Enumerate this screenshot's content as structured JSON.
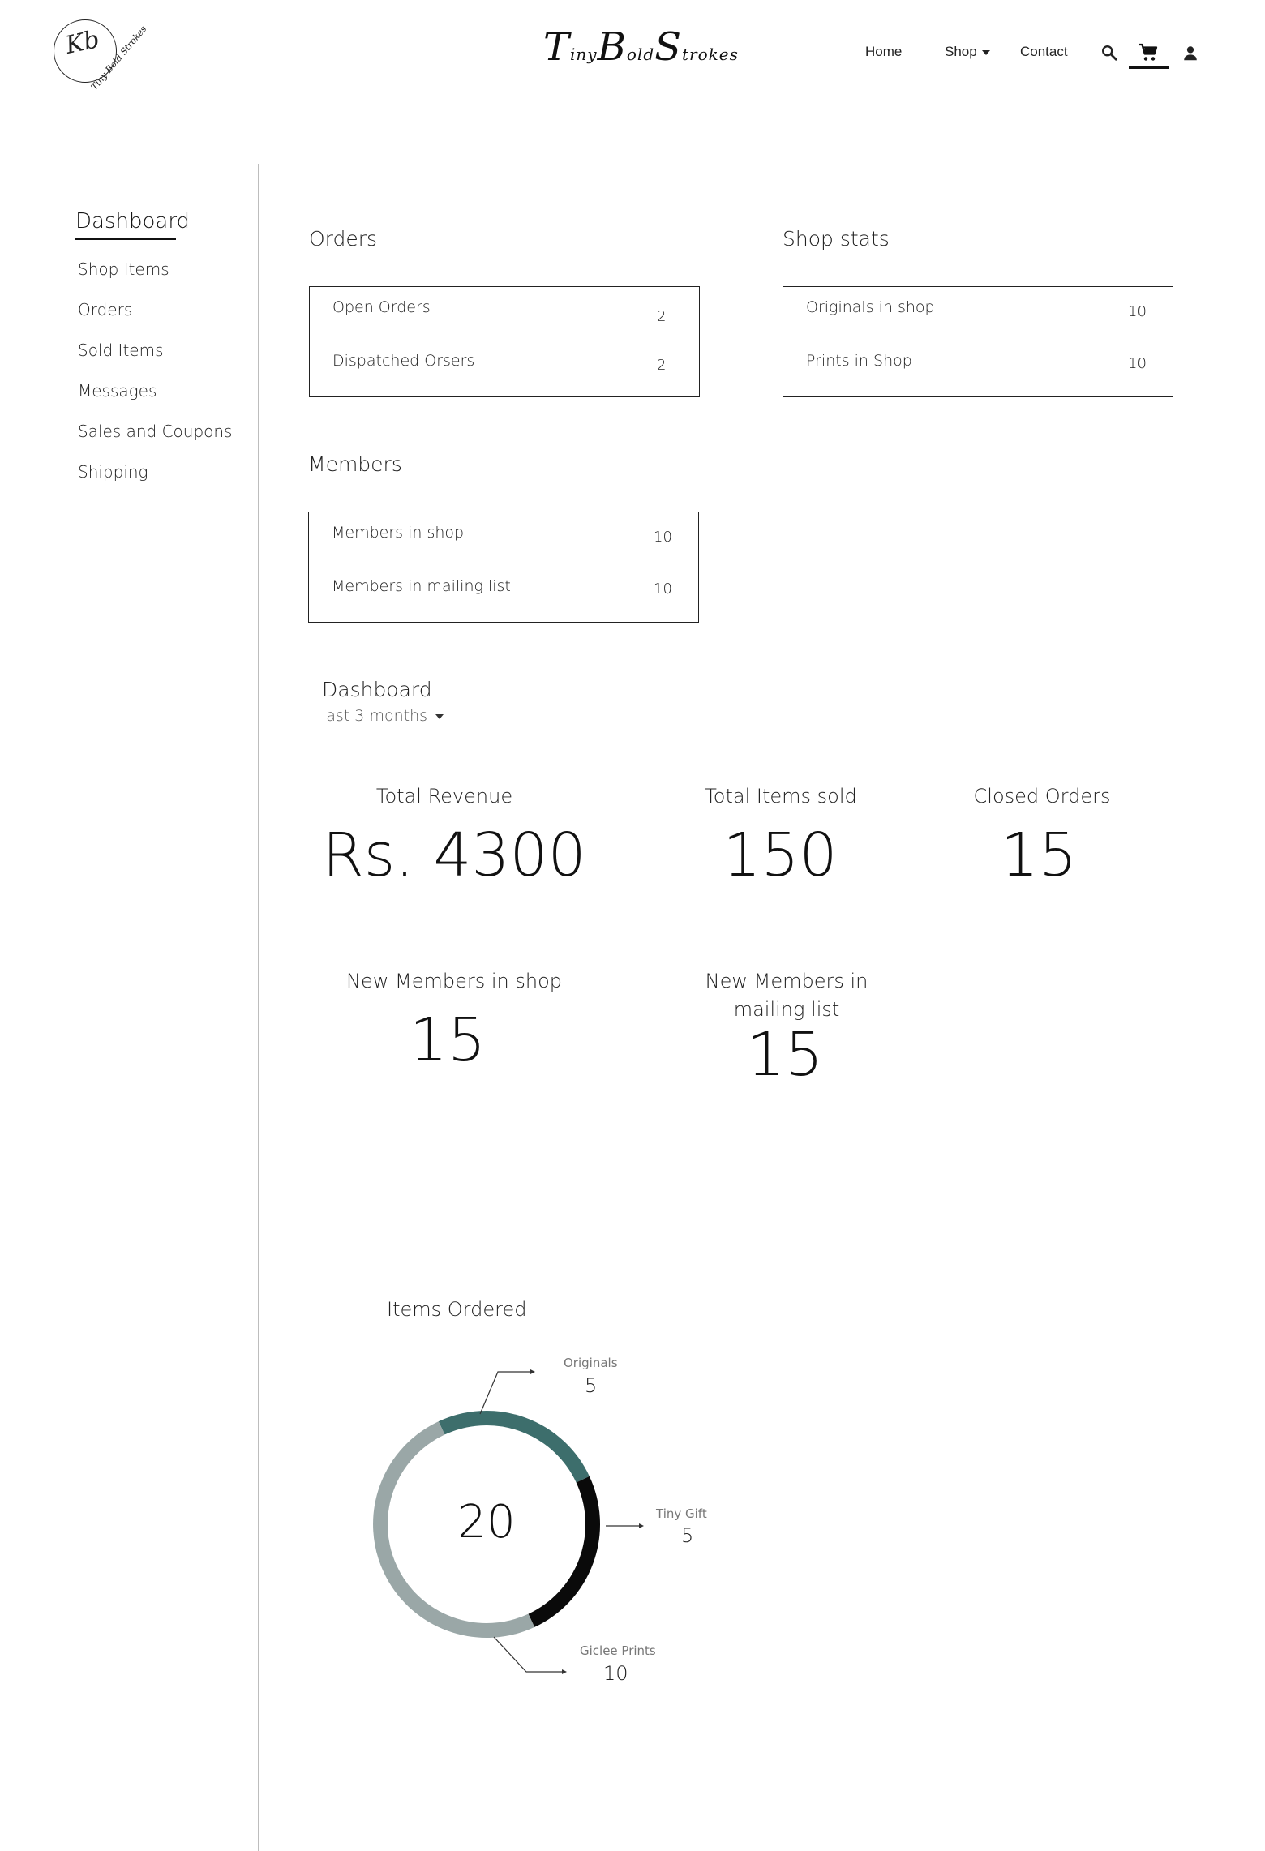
{
  "header": {
    "logo_mark": "Kb",
    "logo_ring_text": "Tiny Bold Strokes",
    "brand_t": "T",
    "brand_iny": "iny",
    "brand_b": "B",
    "brand_old": "old",
    "brand_s": "S",
    "brand_trokes": "trokes",
    "nav": {
      "home": "Home",
      "shop": "Shop",
      "contact": "Contact"
    },
    "icons": {
      "search": "search-icon",
      "cart": "cart-icon",
      "account": "account-icon"
    }
  },
  "sidebar": {
    "title": "Dashboard",
    "items": [
      {
        "label": "Shop Items"
      },
      {
        "label": "Orders"
      },
      {
        "label": "Sold Items"
      },
      {
        "label": "Messages"
      },
      {
        "label": "Sales and Coupons"
      },
      {
        "label": "Shipping"
      }
    ]
  },
  "orders": {
    "title": "Orders",
    "rows": [
      {
        "label": "Open Orders",
        "value": "2"
      },
      {
        "label": "Dispatched Orsers",
        "value": "2"
      }
    ]
  },
  "shop_stats": {
    "title": "Shop stats",
    "rows": [
      {
        "label": "Originals in shop",
        "value": "10"
      },
      {
        "label": "Prints in Shop",
        "value": "10"
      }
    ]
  },
  "members": {
    "title": "Members",
    "rows": [
      {
        "label": "Members in shop",
        "value": "10"
      },
      {
        "label": "Members in mailing list",
        "value": "10"
      }
    ]
  },
  "dashboard": {
    "title": "Dashboard",
    "period": "last 3 months",
    "metrics": {
      "total_revenue": {
        "label": "Total Revenue",
        "value": "Rs. 4300"
      },
      "total_items_sold": {
        "label": "Total Items sold",
        "value": "150"
      },
      "closed_orders": {
        "label": "Closed Orders",
        "value": "15"
      },
      "new_members_shop": {
        "label": "New Members in shop",
        "value": "15"
      },
      "new_members_mailing_line1": "New Members in",
      "new_members_mailing_line2": "mailing list",
      "new_members_mailing_value": "15"
    }
  },
  "items_ordered": {
    "title": "Items Ordered",
    "total": "20",
    "segments": [
      {
        "name": "Originals",
        "value": 5,
        "value_text": "5",
        "color": "#3d6e6c"
      },
      {
        "name": "Tiny Gift",
        "value": 5,
        "value_text": "5",
        "color": "#0a0a0a"
      },
      {
        "name": "Giclee Prints",
        "value": 10,
        "value_text": "10",
        "color": "#9aa7a7"
      }
    ]
  }
}
